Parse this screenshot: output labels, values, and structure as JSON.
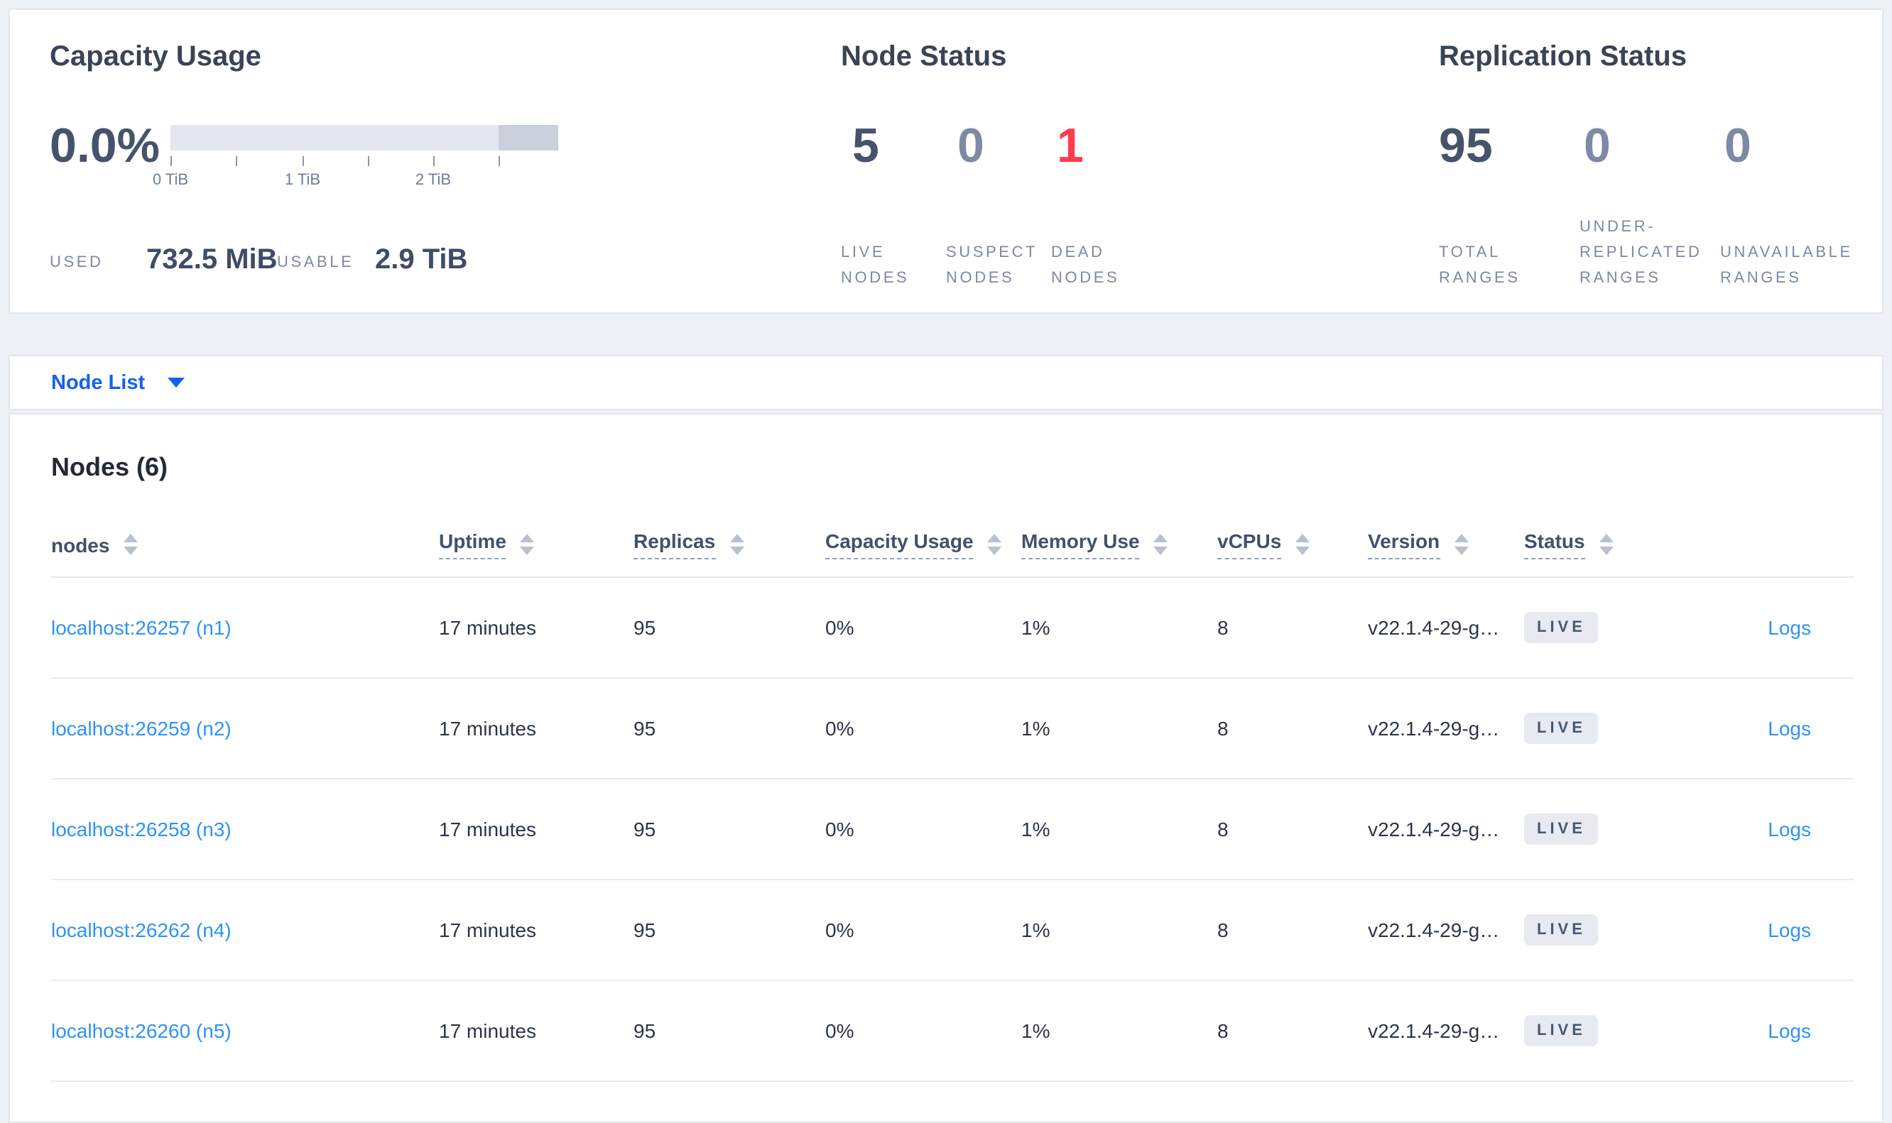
{
  "overview": {
    "capacity": {
      "title": "Capacity Usage",
      "percent": "0.0%",
      "ticks": [
        "0 TiB",
        "1 TiB",
        "2 TiB"
      ],
      "used_label": "USED",
      "used_value": "732.5 MiB",
      "usable_label": "USABLE",
      "usable_value": "2.9 TiB",
      "bar_colors": {
        "track": "#e4e7ee",
        "reserved": "#cbd0dd"
      }
    },
    "node_status": {
      "title": "Node Status",
      "stats": [
        {
          "value": "5",
          "label": "LIVE\nNODES",
          "state": "live"
        },
        {
          "value": "0",
          "label": "SUSPECT\nNODES",
          "state": "suspect"
        },
        {
          "value": "1",
          "label": "DEAD\nNODES",
          "state": "dead"
        }
      ]
    },
    "replication": {
      "title": "Replication Status",
      "stats": [
        {
          "value": "95",
          "label": "TOTAL\nRANGES",
          "state": "total"
        },
        {
          "value": "0",
          "label": "UNDER-\nREPLICATED\nRANGES",
          "state": "under"
        },
        {
          "value": "0",
          "label": "UNAVAILABLE\nRANGES",
          "state": "unavailable"
        }
      ]
    }
  },
  "node_list": {
    "label": "Node List"
  },
  "nodes": {
    "title": "Nodes (6)",
    "columns": [
      {
        "label": "nodes"
      },
      {
        "label": "Uptime"
      },
      {
        "label": "Replicas"
      },
      {
        "label": "Capacity Usage"
      },
      {
        "label": "Memory Use"
      },
      {
        "label": "vCPUs"
      },
      {
        "label": "Version"
      },
      {
        "label": "Status"
      }
    ],
    "rows": [
      {
        "address": "localhost:26257 (n1)",
        "uptime": "17 minutes",
        "replicas": "95",
        "capacity": "0%",
        "memory": "1%",
        "vcpus": "8",
        "version": "v22.1.4-29-g…",
        "status": "LIVE",
        "logs": "Logs"
      },
      {
        "address": "localhost:26259 (n2)",
        "uptime": "17 minutes",
        "replicas": "95",
        "capacity": "0%",
        "memory": "1%",
        "vcpus": "8",
        "version": "v22.1.4-29-g…",
        "status": "LIVE",
        "logs": "Logs"
      },
      {
        "address": "localhost:26258 (n3)",
        "uptime": "17 minutes",
        "replicas": "95",
        "capacity": "0%",
        "memory": "1%",
        "vcpus": "8",
        "version": "v22.1.4-29-g…",
        "status": "LIVE",
        "logs": "Logs"
      },
      {
        "address": "localhost:26262 (n4)",
        "uptime": "17 minutes",
        "replicas": "95",
        "capacity": "0%",
        "memory": "1%",
        "vcpus": "8",
        "version": "v22.1.4-29-g…",
        "status": "LIVE",
        "logs": "Logs"
      },
      {
        "address": "localhost:26260 (n5)",
        "uptime": "17 minutes",
        "replicas": "95",
        "capacity": "0%",
        "memory": "1%",
        "vcpus": "8",
        "version": "v22.1.4-29-g…",
        "status": "LIVE",
        "logs": "Logs"
      }
    ]
  },
  "colors": {
    "accent_blue": "#1660f0",
    "link_blue": "#2e93f5",
    "dead_red": "#ff3b4f",
    "muted_number": "#7e89a3",
    "dark_number": "#46536d",
    "page_background": "#eef1f6"
  }
}
